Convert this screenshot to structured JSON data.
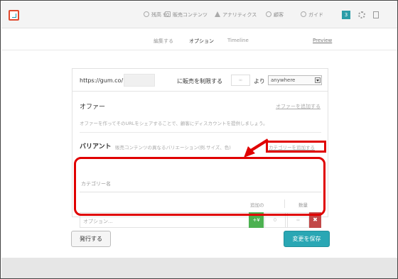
{
  "topbar": {
    "items": [
      {
        "label": "残高 $0",
        "icon": "balance-icon"
      },
      {
        "label": "販売コンテンツ",
        "icon": "products-icon"
      },
      {
        "label": "アナリティクス",
        "icon": "analytics-icon"
      },
      {
        "label": "顧客",
        "icon": "customers-icon"
      },
      {
        "label": "ガイド",
        "icon": "guide-icon"
      }
    ],
    "badge": "3"
  },
  "tabs": [
    {
      "label": "編集する"
    },
    {
      "label": "オプション"
    },
    {
      "label": "Timeline"
    }
  ],
  "preview_label": "Preview",
  "url_row": {
    "url": "https://gum.co/",
    "limit_label": "に販売を制限する",
    "limit_placeholder": "∞",
    "from_label": "より",
    "select_value": "anywhere"
  },
  "offers": {
    "title": "オファー",
    "add_link": "オファーを追加する",
    "description": "オファーを作ってそのURLをシェアすることで、顧客にディスカウントを提供しましょう。"
  },
  "variants": {
    "title": "バリアント",
    "description": "販売コンテンツの異なるバリエーション(例.サイズ、色)",
    "add_link": "カテゴリーを追加する",
    "category_placeholder": "カテゴリー名",
    "col_added": "追加の",
    "col_qty": "数量",
    "option_placeholder": "オプション...",
    "currency_btn": "+¥",
    "price_placeholder": "0",
    "qty_placeholder": "∞",
    "delete_btn": "✖"
  },
  "buttons": {
    "publish": "発行する",
    "save": "変更を保存"
  },
  "colors": {
    "accent": "#2aa7b4",
    "annotation": "#e00000",
    "green": "#4cb151",
    "danger": "#c24848"
  }
}
